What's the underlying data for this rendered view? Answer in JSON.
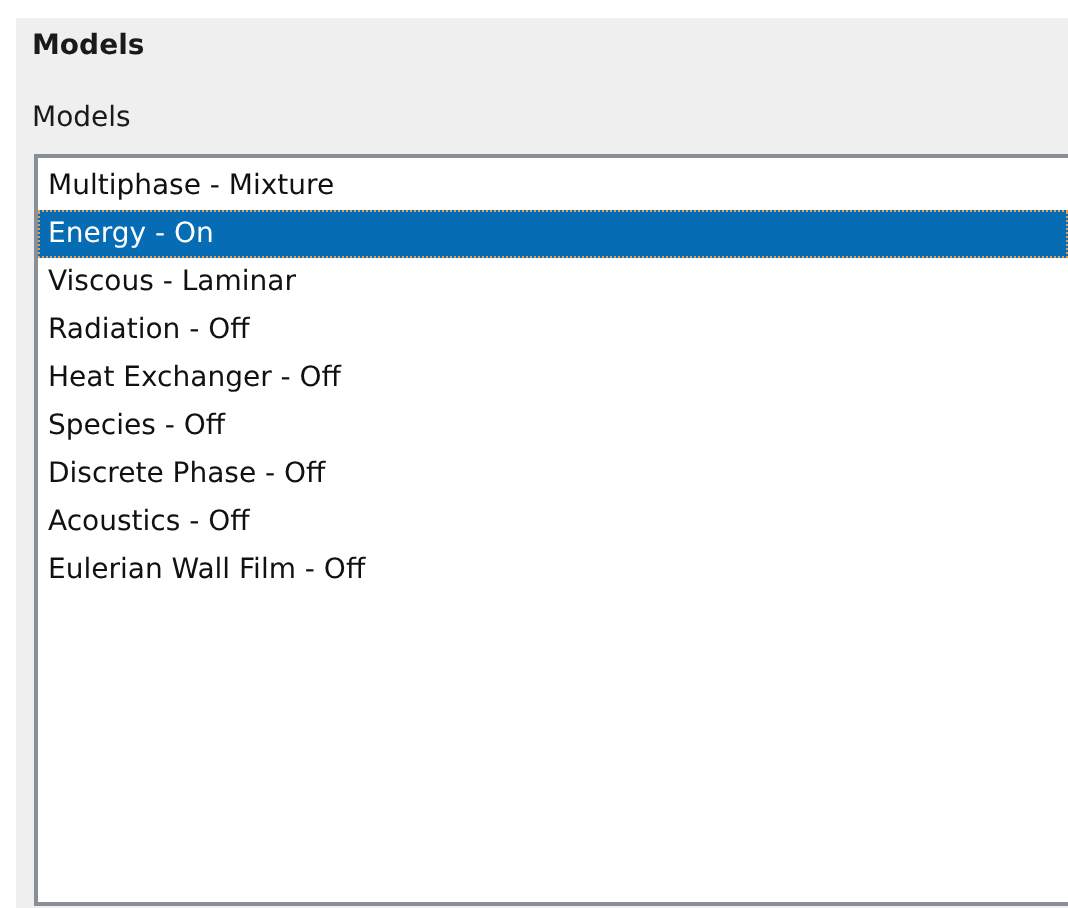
{
  "panel": {
    "title": "Models",
    "label": "Models"
  },
  "models": [
    {
      "label": "Multiphase - Mixture",
      "selected": false
    },
    {
      "label": "Energy - On",
      "selected": true
    },
    {
      "label": "Viscous - Laminar",
      "selected": false
    },
    {
      "label": "Radiation - Off",
      "selected": false
    },
    {
      "label": "Heat Exchanger - Off",
      "selected": false
    },
    {
      "label": "Species - Off",
      "selected": false
    },
    {
      "label": "Discrete Phase - Off",
      "selected": false
    },
    {
      "label": "Acoustics - Off",
      "selected": false
    },
    {
      "label": "Eulerian Wall Film - Off",
      "selected": false
    }
  ]
}
